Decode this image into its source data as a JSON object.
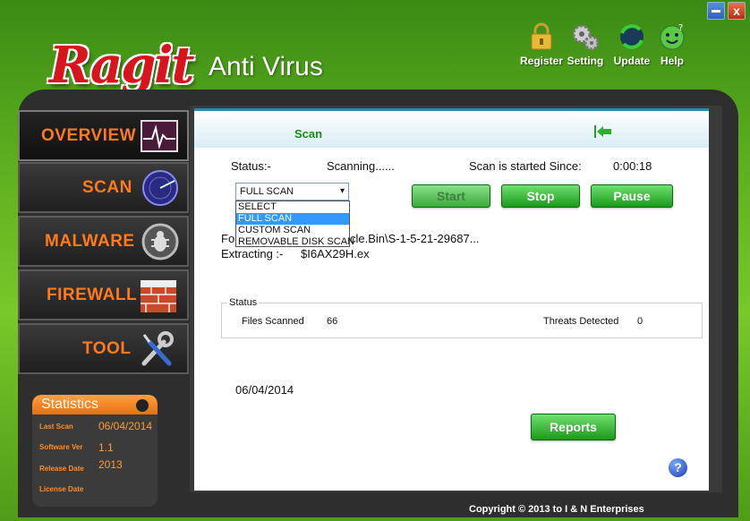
{
  "window": {
    "close_label": "x"
  },
  "logo": {
    "mark": "Ragit",
    "text": "Anti Virus"
  },
  "toolbar": [
    {
      "name": "register",
      "label": "Register",
      "icon": "lock-icon"
    },
    {
      "name": "setting",
      "label": "Setting",
      "icon": "gears-icon"
    },
    {
      "name": "update",
      "label": "Update",
      "icon": "globe-update-icon"
    },
    {
      "name": "help",
      "label": "Help",
      "icon": "smiley-help-icon"
    }
  ],
  "sidebar": {
    "items": [
      {
        "label": "OVERVIEW",
        "icon": "heartbeat-monitor-icon"
      },
      {
        "label": "SCAN",
        "icon": "radar-scan-icon"
      },
      {
        "label": "MALWARE",
        "icon": "bug-icon"
      },
      {
        "label": "FIREWALL",
        "icon": "brick-wall-icon"
      },
      {
        "label": "TOOL",
        "icon": "wrench-screwdriver-icon"
      }
    ]
  },
  "statistics": {
    "title": "Statistics",
    "last_scan_label": "Last Scan",
    "last_scan_value": "06/04/2014",
    "software_ver_label": "Software Ver",
    "software_ver_value": "1.1",
    "release_date_label": "Release Date",
    "release_date_value": "2013",
    "license_date_label": "License Date",
    "license_date_value": ""
  },
  "panel": {
    "header_title": "Scan",
    "status_label": "Status:-",
    "status_value": "Scanning......",
    "started_label": "Scan is started Since:",
    "started_value": "0:00:18",
    "select_value": "FULL SCAN",
    "select_options": [
      "SELECT",
      "FULL SCAN",
      "CUSTOM SCAN",
      "REMOVABLE DISK SCAN"
    ],
    "buttons": {
      "start": "Start",
      "stop": "Stop",
      "pause": "Pause",
      "reports": "Reports"
    },
    "folder_line_prefix": "Fo",
    "folder_line_rest": "cle.Bin\\S-1-5-21-29687...",
    "extracting_label": "Extracting :-",
    "extracting_value": "$I6AX29H.ex",
    "status_group": {
      "legend": "Status",
      "files_scanned_label": "Files Scanned",
      "files_scanned_value": "66",
      "threats_label": "Threats Detected",
      "threats_value": "0"
    },
    "date": "06/04/2014",
    "help_glyph": "?"
  },
  "footer": {
    "copyright": "Copyright © 2013 to I & N Enterprises"
  },
  "colors": {
    "accent_orange": "#ff7a1a",
    "green_button": "#1a9a1a",
    "header_green_text": "#1a8a1a"
  }
}
